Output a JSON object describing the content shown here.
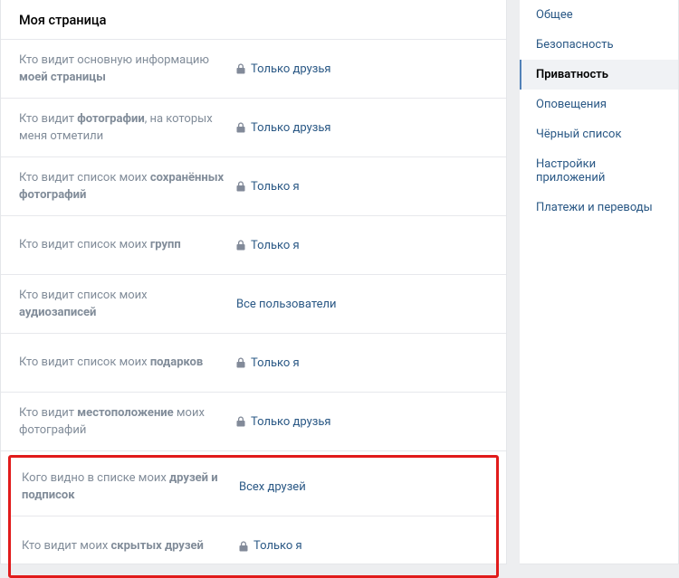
{
  "section_title": "Моя страница",
  "rows": [
    {
      "label_plain": "Кто видит основную информацию ",
      "label_bold": "моей страницы",
      "lock": true,
      "value": "Только друзья"
    },
    {
      "label_plain": "Кто видит ",
      "label_bold": "фотографии",
      "label_tail": ", на которых меня отметили",
      "lock": true,
      "value": "Только друзья"
    },
    {
      "label_plain": "Кто видит список моих ",
      "label_bold": "сохранённых фотографий",
      "lock": true,
      "value": "Только я"
    },
    {
      "label_plain": "Кто видит список моих ",
      "label_bold": "групп",
      "lock": true,
      "value": "Только я"
    },
    {
      "label_plain": "Кто видит список моих ",
      "label_bold": "аудиозаписей",
      "lock": false,
      "value": "Все пользователи"
    },
    {
      "label_plain": "Кто видит список моих ",
      "label_bold": "подарков",
      "lock": true,
      "value": "Только я"
    },
    {
      "label_plain": "Кто видит ",
      "label_bold": "местоположение",
      "label_tail": " моих фотографий",
      "lock": true,
      "value": "Только друзья"
    }
  ],
  "highlight_rows": [
    {
      "label_plain": "Кого видно в списке моих ",
      "label_bold": "друзей и подписок",
      "lock": false,
      "value": "Всех друзей"
    },
    {
      "label_plain": "Кто видит моих ",
      "label_bold": "скрытых друзей",
      "lock": true,
      "value": "Только я"
    }
  ],
  "sidebar": {
    "items": [
      {
        "label": "Общее",
        "active": false
      },
      {
        "label": "Безопасность",
        "active": false
      },
      {
        "label": "Приватность",
        "active": true
      },
      {
        "label": "Оповещения",
        "active": false
      },
      {
        "label": "Чёрный список",
        "active": false
      },
      {
        "label": "Настройки приложений",
        "active": false
      },
      {
        "label": "Платежи и переводы",
        "active": false
      }
    ]
  }
}
